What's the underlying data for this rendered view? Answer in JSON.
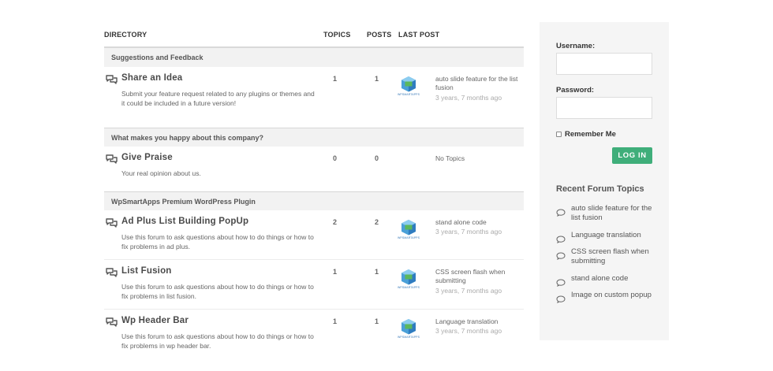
{
  "table_header": {
    "directory": "DIRECTORY",
    "topics": "TOPICS",
    "posts": "POSTS",
    "last_post": "LAST POST"
  },
  "categories": [
    {
      "name": "Suggestions and Feedback",
      "forums": [
        {
          "title": "Share an Idea",
          "description": "Submit your feature request related to any plugins or themes and it could be included in a future version!",
          "topics": "1",
          "posts": "1",
          "last_post_title": "auto slide feature for the list fusion",
          "last_post_time": "3 years, 7 months ago",
          "has_avatar": true
        }
      ]
    },
    {
      "name": "What makes you happy about this company?",
      "forums": [
        {
          "title": "Give Praise",
          "description": "Your real opinion about us.",
          "topics": "0",
          "posts": "0",
          "last_post_title": "No Topics",
          "last_post_time": "",
          "has_avatar": false
        }
      ]
    },
    {
      "name": "WpSmartApps Premium WordPress Plugin",
      "forums": [
        {
          "title": "Ad Plus List Building PopUp",
          "description": "Use this forum to ask questions about how to do things or how to fix problems in ad plus.",
          "topics": "2",
          "posts": "2",
          "last_post_title": "stand alone code",
          "last_post_time": "3 years, 7 months ago",
          "has_avatar": true
        },
        {
          "title": "List Fusion",
          "description": "Use this forum to ask questions about how to do things or how to fix problems in list fusion.",
          "topics": "1",
          "posts": "1",
          "last_post_title": "CSS screen flash when submitting",
          "last_post_time": "3 years, 7 months ago",
          "has_avatar": true
        },
        {
          "title": "Wp Header Bar",
          "description": "Use this forum to ask questions about how to do things or how to fix problems in wp header bar.",
          "topics": "1",
          "posts": "1",
          "last_post_title": "Language translation",
          "last_post_time": "3 years, 7 months ago",
          "has_avatar": true
        }
      ]
    }
  ],
  "avatar_text": "WPSMARTAPPS",
  "login": {
    "username_label": "Username:",
    "password_label": "Password:",
    "username_value": "",
    "password_value": "",
    "remember_label": "Remember Me",
    "remember_checked": false,
    "button_label": "LOG IN"
  },
  "recent_topics": {
    "title": "Recent Forum Topics",
    "items": [
      "auto slide feature for the list fusion",
      "Language translation",
      "CSS screen flash when submitting",
      "stand alone code",
      "Image on custom popup"
    ]
  },
  "colors": {
    "accent": "#3fae7a",
    "category_bg": "#f2f2f2",
    "sidebar_bg": "#f5f5f5"
  }
}
